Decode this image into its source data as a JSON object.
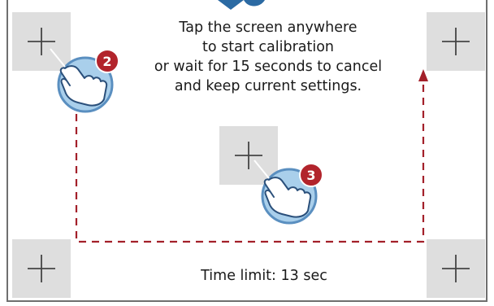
{
  "instructions": {
    "line1": "Tap the screen anywhere",
    "line2": "to start calibration",
    "line3": "or wait for 15 seconds to cancel",
    "line4": "and keep current settings."
  },
  "time_limit": "Time limit: 13 sec",
  "steps": {
    "step2": "2",
    "step3": "3"
  },
  "colors": {
    "path": "#a3202a",
    "badge": "#b2242c",
    "hand_blue": "#a9cfeb",
    "hand_ring": "#5a8fc0",
    "target_bg": "#dedede",
    "top_arrow": "#2b6aa3"
  },
  "icons": [
    "crosshair-icon",
    "hand-tap-icon",
    "dashed-path-arrow"
  ]
}
